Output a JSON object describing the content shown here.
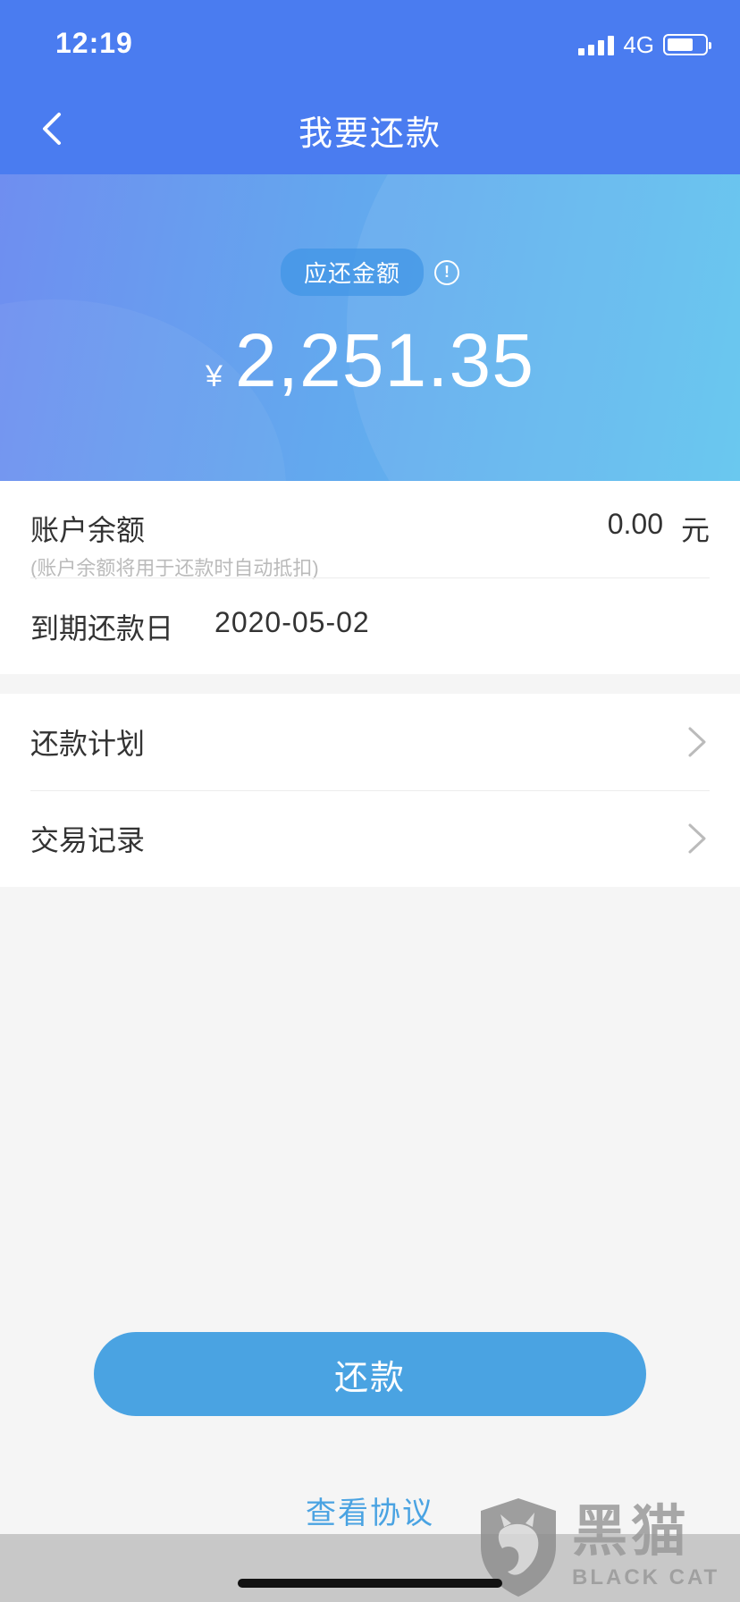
{
  "status_bar": {
    "time": "12:19",
    "network": "4G",
    "battery_level": 0.7
  },
  "nav": {
    "title": "我要还款",
    "back_icon": "chevron-left-icon"
  },
  "hero": {
    "label": "应还金额",
    "info_icon": "info-icon",
    "info_symbol": "!",
    "currency": "¥",
    "amount": "2,251.35"
  },
  "account": {
    "balance_label": "账户余额",
    "balance_note": "(账户余额将用于还款时自动抵扣)",
    "balance_value": "0.00",
    "balance_unit": "元",
    "due_label": "到期还款日",
    "due_date": "2020-05-02"
  },
  "menu": [
    {
      "label": "还款计划",
      "icon": "chevron-right-icon"
    },
    {
      "label": "交易记录",
      "icon": "chevron-right-icon"
    }
  ],
  "actions": {
    "repay_label": "还款",
    "agreement_label": "查看协议"
  },
  "watermark": {
    "cn": "黑猫",
    "en": "BLACK CAT"
  },
  "colors": {
    "nav_blue": "#4a7cf0",
    "accent": "#4aa3e2",
    "hero_start": "#6f8ef0",
    "hero_end": "#5fc4ee"
  }
}
